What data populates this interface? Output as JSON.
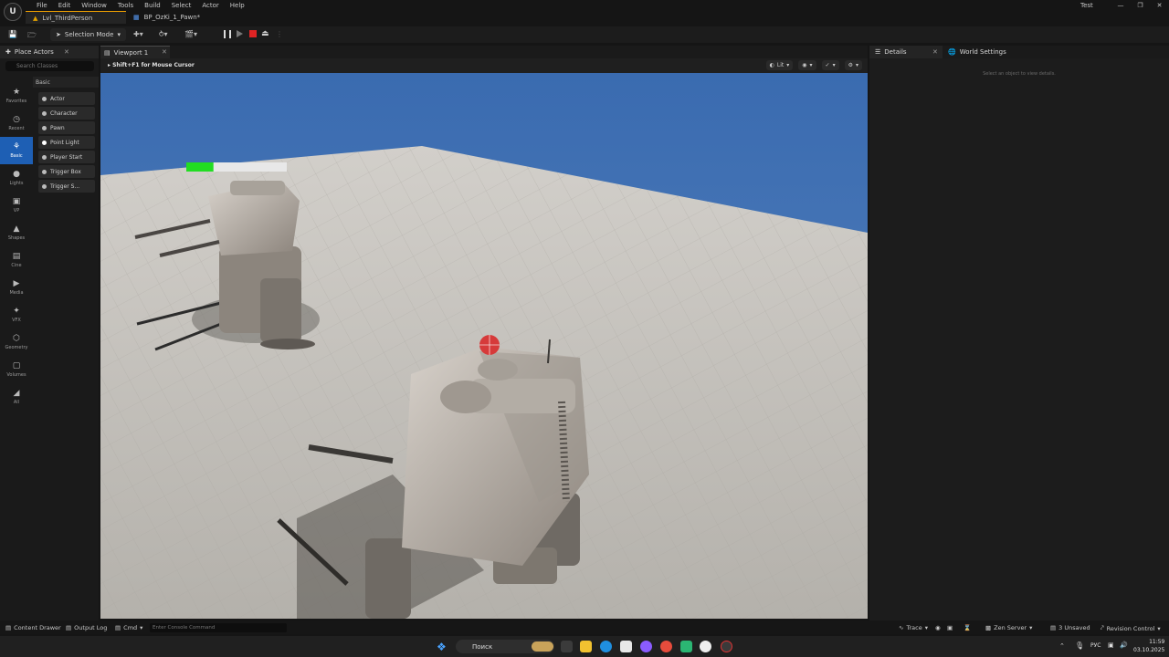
{
  "app": {
    "logo_letter": "U",
    "menu": [
      "File",
      "Edit",
      "Window",
      "Tools",
      "Build",
      "Select",
      "Actor",
      "Help"
    ],
    "user": "Test"
  },
  "tabs": {
    "level": "Lvl_ThirdPerson",
    "blueprint": "BP_OzKi_1_Pawn*"
  },
  "toolbar": {
    "selection_mode": "Selection Mode"
  },
  "place_actors": {
    "title": "Place Actors",
    "search_placeholder": "Search Classes",
    "categories": [
      "Favorites",
      "Recent",
      "Basic",
      "Lights",
      "VP",
      "Shapes",
      "Cine",
      "Media",
      "VFX",
      "Geometry",
      "Volumes",
      "All"
    ],
    "active_category": "Basic",
    "section": "Basic",
    "items": [
      "Actor",
      "Character",
      "Pawn",
      "Point Light",
      "Player Start",
      "Trigger Box",
      "Trigger S..."
    ]
  },
  "viewport": {
    "tab": "Viewport 1",
    "hint": "Shift+F1 for Mouse Cursor",
    "view_mode": "Lit",
    "health_fraction": 0.27
  },
  "details": {
    "tab": "Details",
    "world_settings_tab": "World Settings",
    "empty_message": "Select an object to view details."
  },
  "statusbar": {
    "content_drawer": "Content Drawer",
    "output_log": "Output Log",
    "cmd": "Cmd",
    "console_placeholder": "Enter Console Command",
    "trace": "Trace",
    "zen_server": "Zen Server",
    "unsaved": "3 Unsaved",
    "revision_control": "Revision Control"
  },
  "taskbar": {
    "search": "Поиск",
    "language": "РУС",
    "time": "11:59",
    "date": "03.10.2025"
  },
  "colors": {
    "accent": "#1e5fb4",
    "tab_highlight": "#f0a000",
    "stop_button": "#e02424",
    "health_fill": "#22dd22",
    "sky": "#3a6db0",
    "ground": "#bdbab4"
  }
}
